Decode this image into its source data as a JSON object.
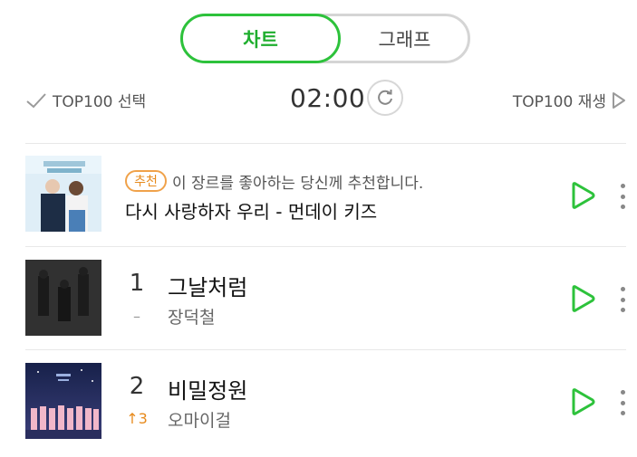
{
  "tabs": {
    "chart": "차트",
    "graph": "그래프"
  },
  "controls": {
    "select_label": "TOP100 선택",
    "timer": "02:00",
    "play_label": "TOP100 재생"
  },
  "recommendation": {
    "badge": "추천",
    "text": "이 장르를 좋아하는 당신께 추천합니다.",
    "song": "다시 사랑하자 우리 - 먼데이 키즈"
  },
  "songs": [
    {
      "rank": "1",
      "change": "–",
      "title": "그날처럼",
      "artist": "장덕철"
    },
    {
      "rank": "2",
      "change": "↑3",
      "title": "비밀정원",
      "artist": "오마이걸"
    }
  ],
  "colors": {
    "accent_green": "#2dc23b",
    "badge_orange": "#f0a24a",
    "rank_up": "#e78a1c"
  },
  "icons": [
    "check-icon",
    "refresh-icon",
    "play-icon",
    "more-icon"
  ]
}
